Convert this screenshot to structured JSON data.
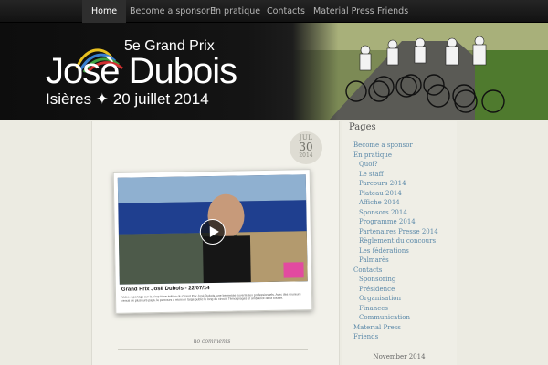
{
  "nav": {
    "items": [
      {
        "label": "Home",
        "active": true
      },
      {
        "label": "Become a sponsor !"
      },
      {
        "label": "En pratique"
      },
      {
        "label": "Contacts"
      },
      {
        "label": "Material Press"
      },
      {
        "label": "Friends"
      }
    ]
  },
  "header": {
    "title": "5e Grand Prix",
    "name": "Josè Dubois",
    "subtitle": "Isières ✦ 20 juillet 2014"
  },
  "post": {
    "date": {
      "month": "JUL",
      "day": "30",
      "year": "2014"
    },
    "video": {
      "title": "Grand Prix Josè Dubois - 22/07/14",
      "description": "Video reportage sur la cinquième édition du Grand Prix José Dubois, une kermesse ouverte aux professionnels. Avec des coureurs venus de plusieurs pays, le parcours a réuni un large public le long du circuit. Témoignages et ambiance de la course."
    },
    "comments": "no comments"
  },
  "sidebar": {
    "heading": "Pages",
    "items": [
      {
        "label": "Become a sponsor !",
        "level": 0
      },
      {
        "label": "En pratique",
        "level": 0
      },
      {
        "label": "Quoi?",
        "level": 1
      },
      {
        "label": "Le staff",
        "level": 1
      },
      {
        "label": "Parcours 2014",
        "level": 1
      },
      {
        "label": "Plateau 2014",
        "level": 1
      },
      {
        "label": "Affiche 2014",
        "level": 1
      },
      {
        "label": "Sponsors 2014",
        "level": 1
      },
      {
        "label": "Programme 2014",
        "level": 1
      },
      {
        "label": "Partenaires Presse 2014",
        "level": 1
      },
      {
        "label": "Règlement du concours",
        "level": 1
      },
      {
        "label": "Les fédérations",
        "level": 1
      },
      {
        "label": "Palmarès",
        "level": 1
      },
      {
        "label": "Contacts",
        "level": 0
      },
      {
        "label": "Sponsoring",
        "level": 1
      },
      {
        "label": "Présidence",
        "level": 1
      },
      {
        "label": "Organisation",
        "level": 1
      },
      {
        "label": "Finances",
        "level": 1
      },
      {
        "label": "Communication",
        "level": 1
      },
      {
        "label": "Material Press",
        "level": 0
      },
      {
        "label": "Friends",
        "level": 0
      }
    ],
    "calendar_title": "November 2014"
  },
  "colors": {
    "link": "#5a88a8",
    "nav_bg": "#1a1a1a",
    "page_bg": "#ecebe2"
  }
}
